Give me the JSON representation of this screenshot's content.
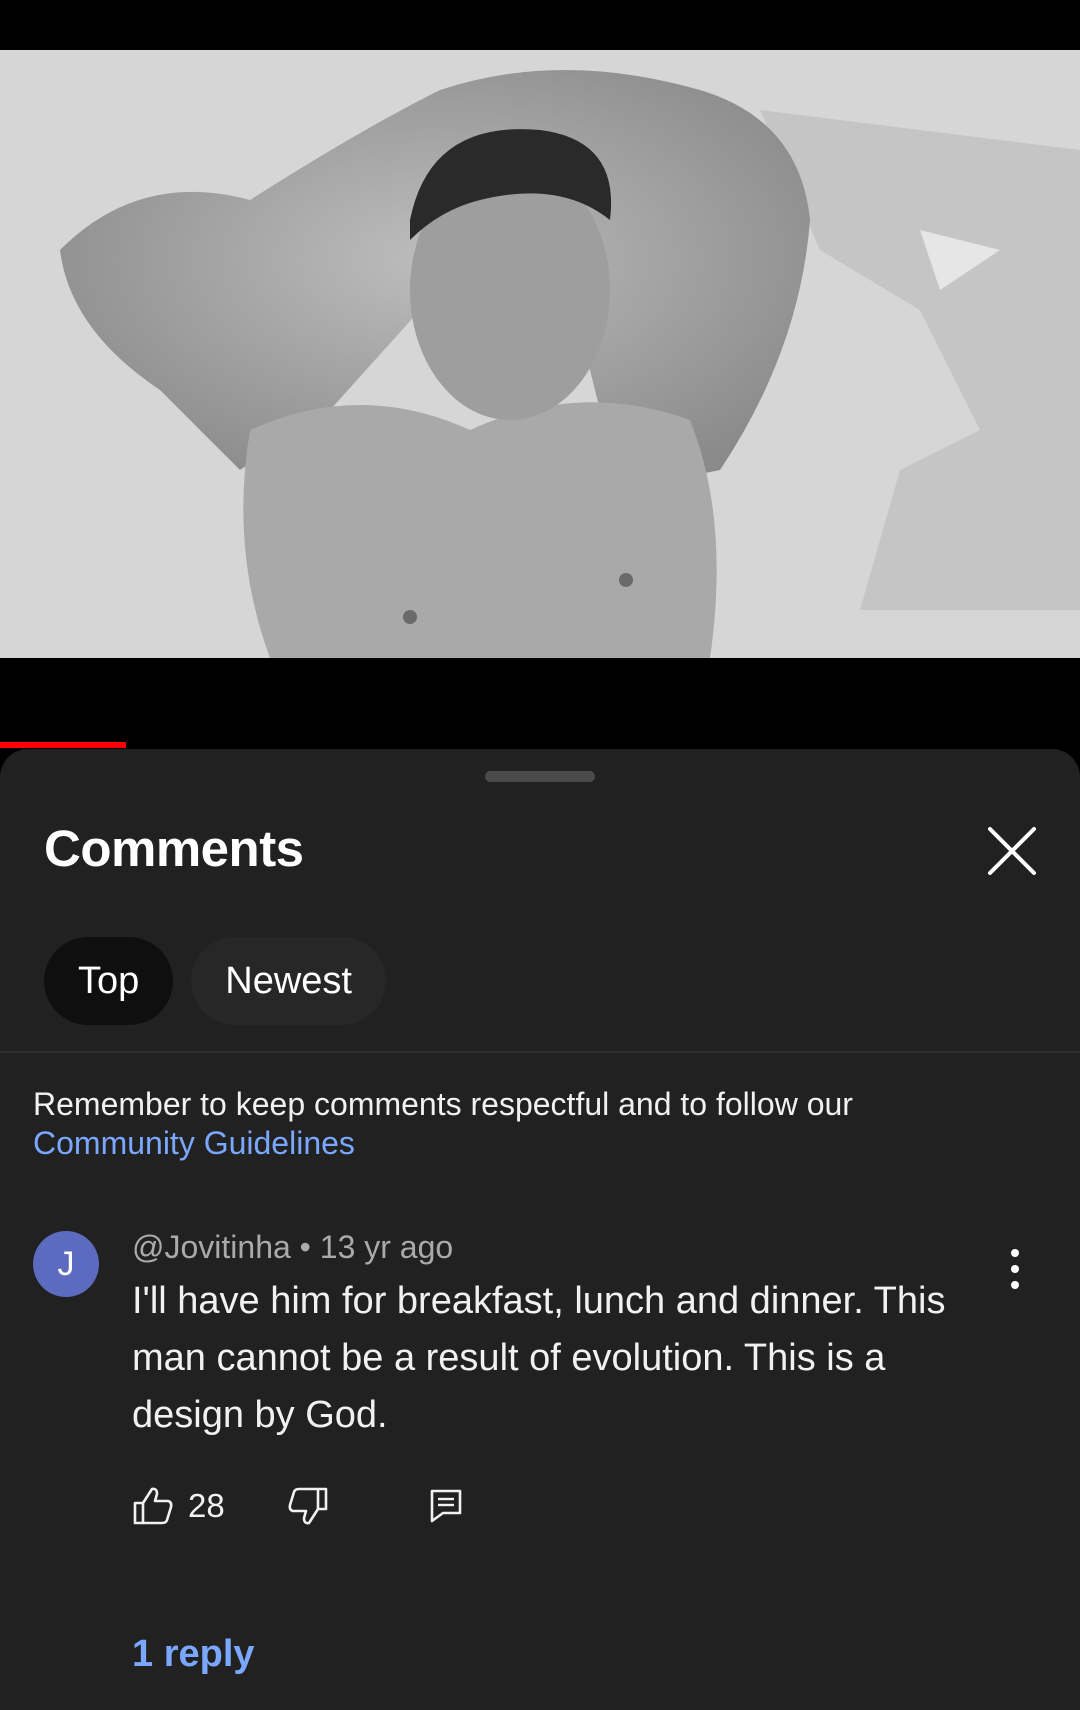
{
  "video": {
    "thumbnail_icon": "video-frame-image",
    "progress_fraction": 0.117,
    "progress_color": "#ff0000"
  },
  "comments_sheet": {
    "title": "Comments",
    "close_icon": "close-icon",
    "sort_chips": [
      {
        "label": "Top",
        "selected": true
      },
      {
        "label": "Newest",
        "selected": false
      }
    ],
    "notice_text": "Remember to keep comments respectful and to follow our",
    "notice_link": "Community Guidelines",
    "link_color": "#7aa7ff"
  },
  "comment": {
    "avatar_letter": "J",
    "avatar_color": "#5c6bc0",
    "author": "@Jovitinha",
    "separator": "•",
    "time": "13 yr ago",
    "text": "I'll have him for breakfast, lunch and dinner. This man cannot be a result of evolution. This is a design by God.",
    "likes": "28",
    "like_icon": "thumbs-up-icon",
    "dislike_icon": "thumbs-down-icon",
    "reply_icon": "reply-comment-icon",
    "more_icon": "more-vertical-icon",
    "replies_label": "1 reply"
  }
}
